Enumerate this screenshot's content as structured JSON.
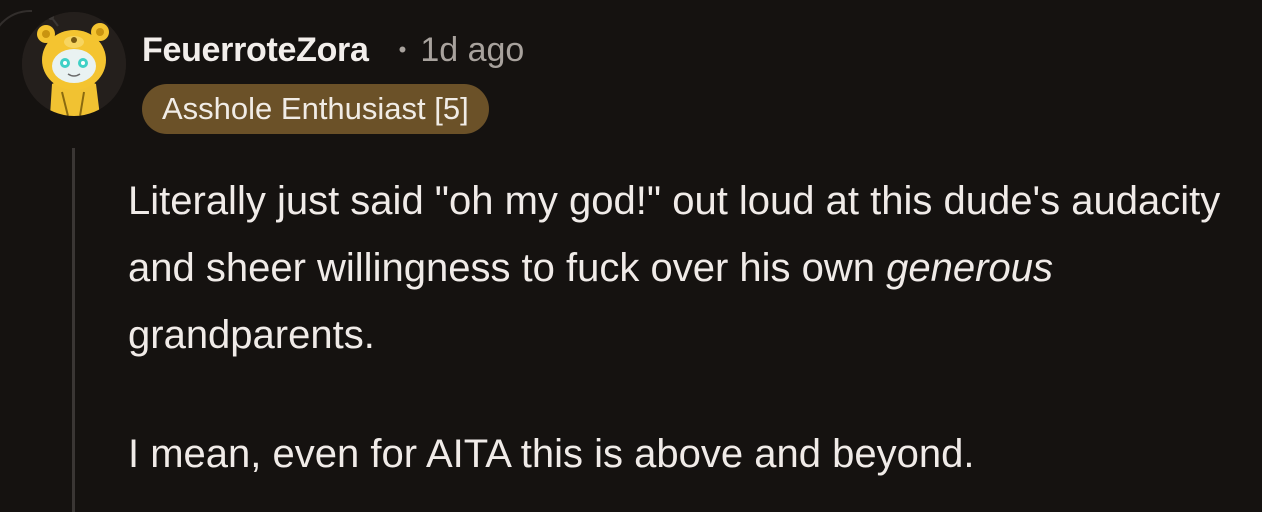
{
  "comment": {
    "author": "FeuerroteZora",
    "separator": "•",
    "timestamp": "1d ago",
    "flair": "Asshole Enthusiast [5]",
    "body": {
      "p1_before": "Literally just said \"oh my god!\" out loud at this dude's audacity and sheer willingness to fuck over his own ",
      "p1_emphasis": "generous",
      "p1_after": " grandparents.",
      "p2": "I mean, even for AITA this is above and beyond."
    }
  },
  "colors": {
    "background": "#151210",
    "text": "#f0ebe8",
    "muted": "#a8a29d",
    "flair_bg": "#6b5128",
    "thread_line": "#3a3634"
  },
  "icons": {
    "avatar": "snoo-bear-avatar-icon"
  }
}
